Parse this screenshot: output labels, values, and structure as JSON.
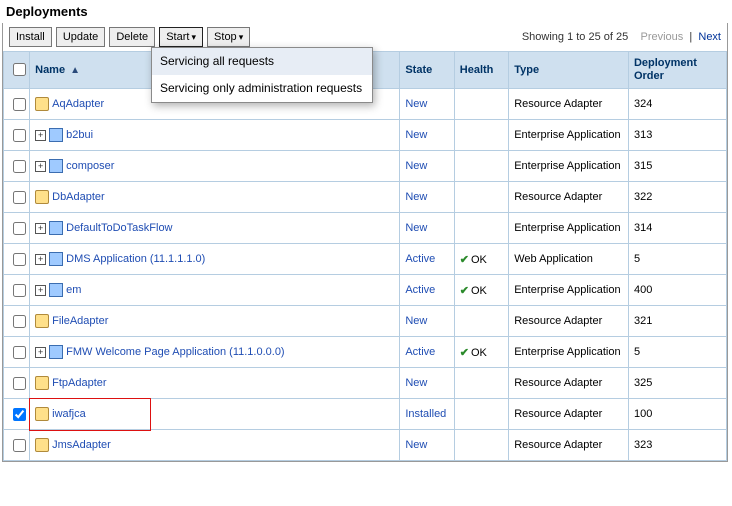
{
  "title": "Deployments",
  "toolbar": {
    "install": "Install",
    "update": "Update",
    "delete": "Delete",
    "start": "Start",
    "stop": "Stop"
  },
  "start_menu": {
    "item1": "Servicing all requests",
    "item2": "Servicing only administration requests"
  },
  "pagination": {
    "showing": "Showing 1 to 25 of 25",
    "prev": "Previous",
    "next": "Next"
  },
  "columns": {
    "name": "Name",
    "state": "State",
    "health": "Health",
    "type": "Type",
    "order": "Deployment Order"
  },
  "states": {
    "New": "New",
    "Active": "Active",
    "Installed": "Installed"
  },
  "health": {
    "ok": "OK"
  },
  "types": {
    "adapter": "Resource Adapter",
    "ent": "Enterprise Application",
    "web": "Web Application"
  },
  "rows": [
    {
      "name": "AqAdapter",
      "icon": "adapter",
      "expand": false,
      "state": "New",
      "health": "",
      "type": "adapter",
      "order": "324",
      "checked": false
    },
    {
      "name": "b2bui",
      "icon": "ent",
      "expand": true,
      "state": "New",
      "health": "",
      "type": "ent",
      "order": "313",
      "checked": false
    },
    {
      "name": "composer",
      "icon": "ent",
      "expand": true,
      "state": "New",
      "health": "",
      "type": "ent",
      "order": "315",
      "checked": false
    },
    {
      "name": "DbAdapter",
      "icon": "adapter",
      "expand": false,
      "state": "New",
      "health": "",
      "type": "adapter",
      "order": "322",
      "checked": false
    },
    {
      "name": "DefaultToDoTaskFlow",
      "icon": "ent",
      "expand": true,
      "state": "New",
      "health": "",
      "type": "ent",
      "order": "314",
      "checked": false
    },
    {
      "name": "DMS Application (11.1.1.1.0)",
      "icon": "ent",
      "expand": true,
      "state": "Active",
      "health": "ok",
      "type": "web",
      "order": "5",
      "checked": false
    },
    {
      "name": "em",
      "icon": "ent",
      "expand": true,
      "state": "Active",
      "health": "ok",
      "type": "ent",
      "order": "400",
      "checked": false
    },
    {
      "name": "FileAdapter",
      "icon": "adapter",
      "expand": false,
      "state": "New",
      "health": "",
      "type": "adapter",
      "order": "321",
      "checked": false
    },
    {
      "name": "FMW Welcome Page Application (11.1.0.0.0)",
      "icon": "ent",
      "expand": true,
      "state": "Active",
      "health": "ok",
      "type": "ent",
      "order": "5",
      "checked": false
    },
    {
      "name": "FtpAdapter",
      "icon": "adapter",
      "expand": false,
      "state": "New",
      "health": "",
      "type": "adapter",
      "order": "325",
      "checked": false
    },
    {
      "name": "iwafjca",
      "icon": "adapter",
      "expand": false,
      "state": "Installed",
      "health": "",
      "type": "adapter",
      "order": "100",
      "checked": true,
      "highlight": true
    },
    {
      "name": "JmsAdapter",
      "icon": "adapter",
      "expand": false,
      "state": "New",
      "health": "",
      "type": "adapter",
      "order": "323",
      "checked": false
    }
  ]
}
